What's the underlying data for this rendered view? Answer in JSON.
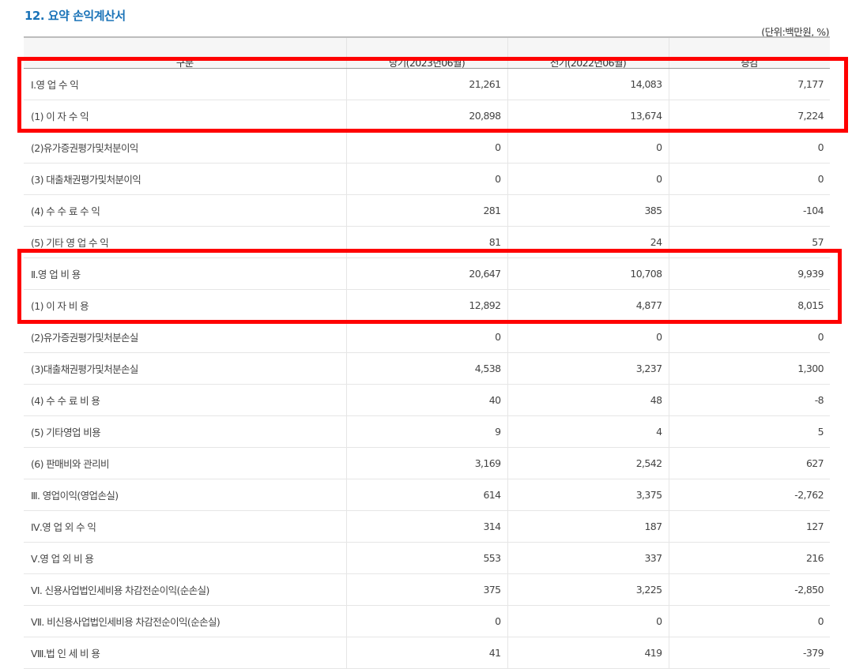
{
  "section": {
    "title": "12. 요약 손익계산서",
    "unit_note": "(단위:백만원, %)"
  },
  "table": {
    "headers": [
      "구분",
      "당기(2023년06월)",
      "전기(2022년06월)",
      "증감"
    ],
    "rows": [
      {
        "label": "Ⅰ.영 업 수 익",
        "current": "21,261",
        "previous": "14,083",
        "change": "7,177"
      },
      {
        "label": "(1) 이 자 수 익",
        "current": "20,898",
        "previous": "13,674",
        "change": "7,224"
      },
      {
        "label": "(2)유가증권평가및처분이익",
        "current": "0",
        "previous": "0",
        "change": "0"
      },
      {
        "label": "(3) 대출채권평가및처분이익",
        "current": "0",
        "previous": "0",
        "change": "0"
      },
      {
        "label": "(4) 수 수 료 수 익",
        "current": "281",
        "previous": "385",
        "change": "-104"
      },
      {
        "label": "(5) 기타 영 업 수 익",
        "current": "81",
        "previous": "24",
        "change": "57"
      },
      {
        "label": "Ⅱ.영 업 비 용",
        "current": "20,647",
        "previous": "10,708",
        "change": "9,939"
      },
      {
        "label": "(1) 이 자 비 용",
        "current": "12,892",
        "previous": "4,877",
        "change": "8,015"
      },
      {
        "label": "(2)유가증권평가및처분손실",
        "current": "0",
        "previous": "0",
        "change": "0"
      },
      {
        "label": "(3)대출채권평가및처분손실",
        "current": "4,538",
        "previous": "3,237",
        "change": "1,300"
      },
      {
        "label": "(4) 수 수 료 비 용",
        "current": "40",
        "previous": "48",
        "change": "-8"
      },
      {
        "label": "(5) 기타영업 비용",
        "current": "9",
        "previous": "4",
        "change": "5"
      },
      {
        "label": "(6) 판매비와 관리비",
        "current": "3,169",
        "previous": "2,542",
        "change": "627"
      },
      {
        "label": "Ⅲ. 영업이익(영업손실)",
        "current": "614",
        "previous": "3,375",
        "change": "-2,762"
      },
      {
        "label": "Ⅳ.영 업 외 수 익",
        "current": "314",
        "previous": "187",
        "change": "127"
      },
      {
        "label": "Ⅴ.영 업 외 비 용",
        "current": "553",
        "previous": "337",
        "change": "216"
      },
      {
        "label": "Ⅵ. 신용사업법인세비용 차감전순이익(순손실)",
        "current": "375",
        "previous": "3,225",
        "change": "-2,850"
      },
      {
        "label": "Ⅶ. 비신용사업법인세비용 차감전순이익(순손실)",
        "current": "0",
        "previous": "0",
        "change": "0"
      },
      {
        "label": "Ⅷ.법 인 세 비 용",
        "current": "41",
        "previous": "419",
        "change": "-379"
      }
    ]
  },
  "highlight_color": "#ff0000"
}
